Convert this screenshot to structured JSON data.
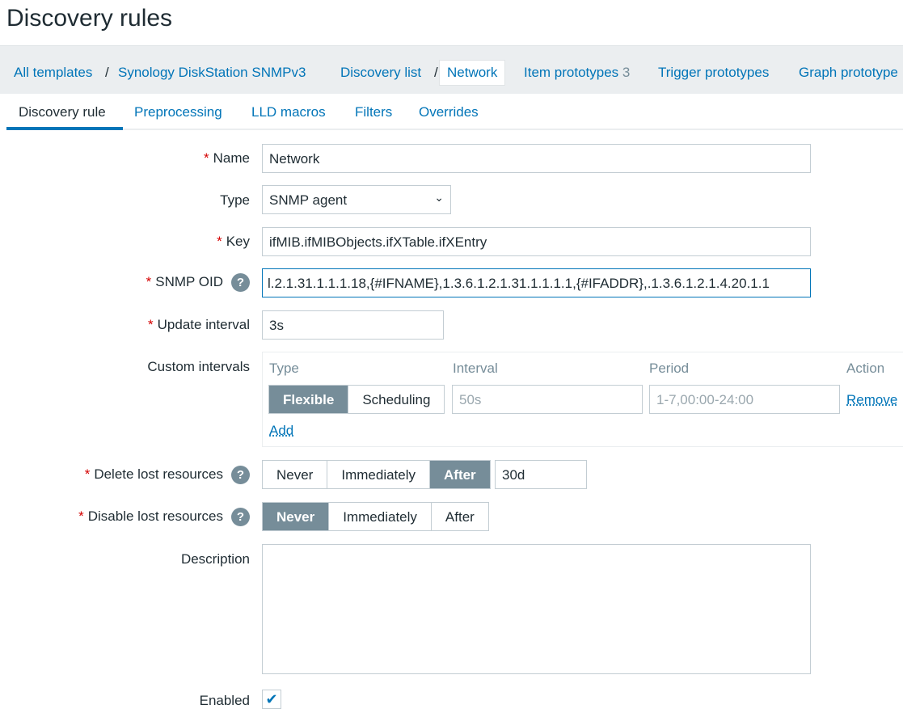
{
  "title": "Discovery rules",
  "breadcrumb": {
    "all_templates": "All templates",
    "template": "Synology DiskStation SNMPv3",
    "discovery_list": "Discovery list",
    "current": "Network",
    "item_prototypes": "Item prototypes",
    "item_count": "3",
    "trigger_prototypes": "Trigger prototypes",
    "graph_prototypes": "Graph prototype"
  },
  "tabs": [
    "Discovery rule",
    "Preprocessing",
    "LLD macros",
    "Filters",
    "Overrides"
  ],
  "form": {
    "name_label": "Name",
    "name": "Network",
    "type_label": "Type",
    "type": "SNMP agent",
    "key_label": "Key",
    "key": "ifMIB.ifMIBObjects.ifXTable.ifXEntry",
    "oid_label": "SNMP OID",
    "oid": "l.2.1.31.1.1.1.18,{#IFNAME},1.3.6.1.2.1.31.1.1.1.1,{#IFADDR},.1.3.6.1.2.1.4.20.1.1",
    "update_label": "Update interval",
    "update": "3s",
    "custom_label": "Custom intervals",
    "custom": {
      "type_h": "Type",
      "interval_h": "Interval",
      "period_h": "Period",
      "action_h": "Action",
      "flexible": "Flexible",
      "scheduling": "Scheduling",
      "interval_ph": "50s",
      "period_ph": "1-7,00:00-24:00",
      "remove": "Remove",
      "add": "Add"
    },
    "delete_label": "Delete lost resources",
    "delete_opts": [
      "Never",
      "Immediately",
      "After"
    ],
    "delete_value": "30d",
    "disable_label": "Disable lost resources",
    "disable_opts": [
      "Never",
      "Immediately",
      "After"
    ],
    "description_label": "Description",
    "description": "",
    "enabled_label": "Enabled",
    "enabled": true
  }
}
